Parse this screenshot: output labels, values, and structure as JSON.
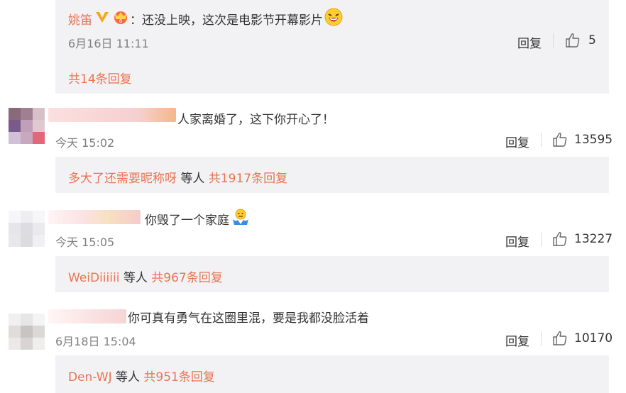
{
  "top_reply": {
    "username": "姚笛",
    "text": "：还没上映，这次是电影节开幕影片",
    "time": "6月16日 11:11",
    "reply_label": "回复",
    "likes": "5",
    "total_replies": "共14条回复"
  },
  "comments": [
    {
      "text": "人家离婚了，这下你开心了！",
      "time": "今天 15:02",
      "reply_label": "回复",
      "likes": "13595",
      "replier": "多大了还需要昵称呀",
      "replier_suffix": "等人",
      "total_replies": "共1917条回复"
    },
    {
      "text": "你毁了一个家庭",
      "time": "今天 15:05",
      "reply_label": "回复",
      "likes": "13227",
      "replier": "WeiDiiiiii",
      "replier_suffix": "等人",
      "total_replies": "共967条回复"
    },
    {
      "text": "你可真有勇气在这圈里混，要是我都没脸活着",
      "time": "6月18日 15:04",
      "reply_label": "回复",
      "likes": "10170",
      "replier": "Den-WJ",
      "replier_suffix": "等人",
      "total_replies": "共951条回复"
    }
  ],
  "colors": {
    "accent": "#eb7350",
    "panel": "#f2f2f5",
    "verified": "#f5a623",
    "text": "#333333",
    "meta": "#808080"
  }
}
